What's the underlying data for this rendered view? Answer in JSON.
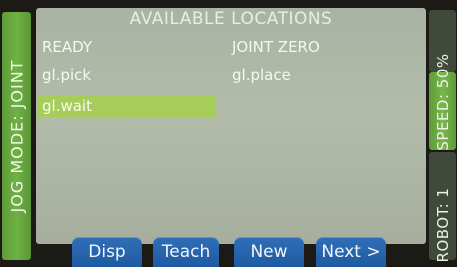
{
  "jog_mode": "JOG MODE: JOINT",
  "right_tabs": {
    "top": "",
    "speed": "SPEED: 50%",
    "robot": "ROBOT: 1"
  },
  "title": "AVAILABLE LOCATIONS",
  "locations": [
    {
      "label": "READY",
      "selected": false
    },
    {
      "label": "JOINT ZERO",
      "selected": false
    },
    {
      "label": "gl.pick",
      "selected": false
    },
    {
      "label": "gl.place",
      "selected": false
    },
    {
      "label": "gl.wait",
      "selected": true
    }
  ],
  "softkeys": {
    "disp": "Disp",
    "teach": "Teach",
    "new": "New",
    "next": "Next >"
  },
  "colors": {
    "panel": "#b2bca9",
    "selected_row": "#a6cd5a",
    "side_bar_green": "#6eb245",
    "softkey_blue": "#2f6fb8"
  }
}
